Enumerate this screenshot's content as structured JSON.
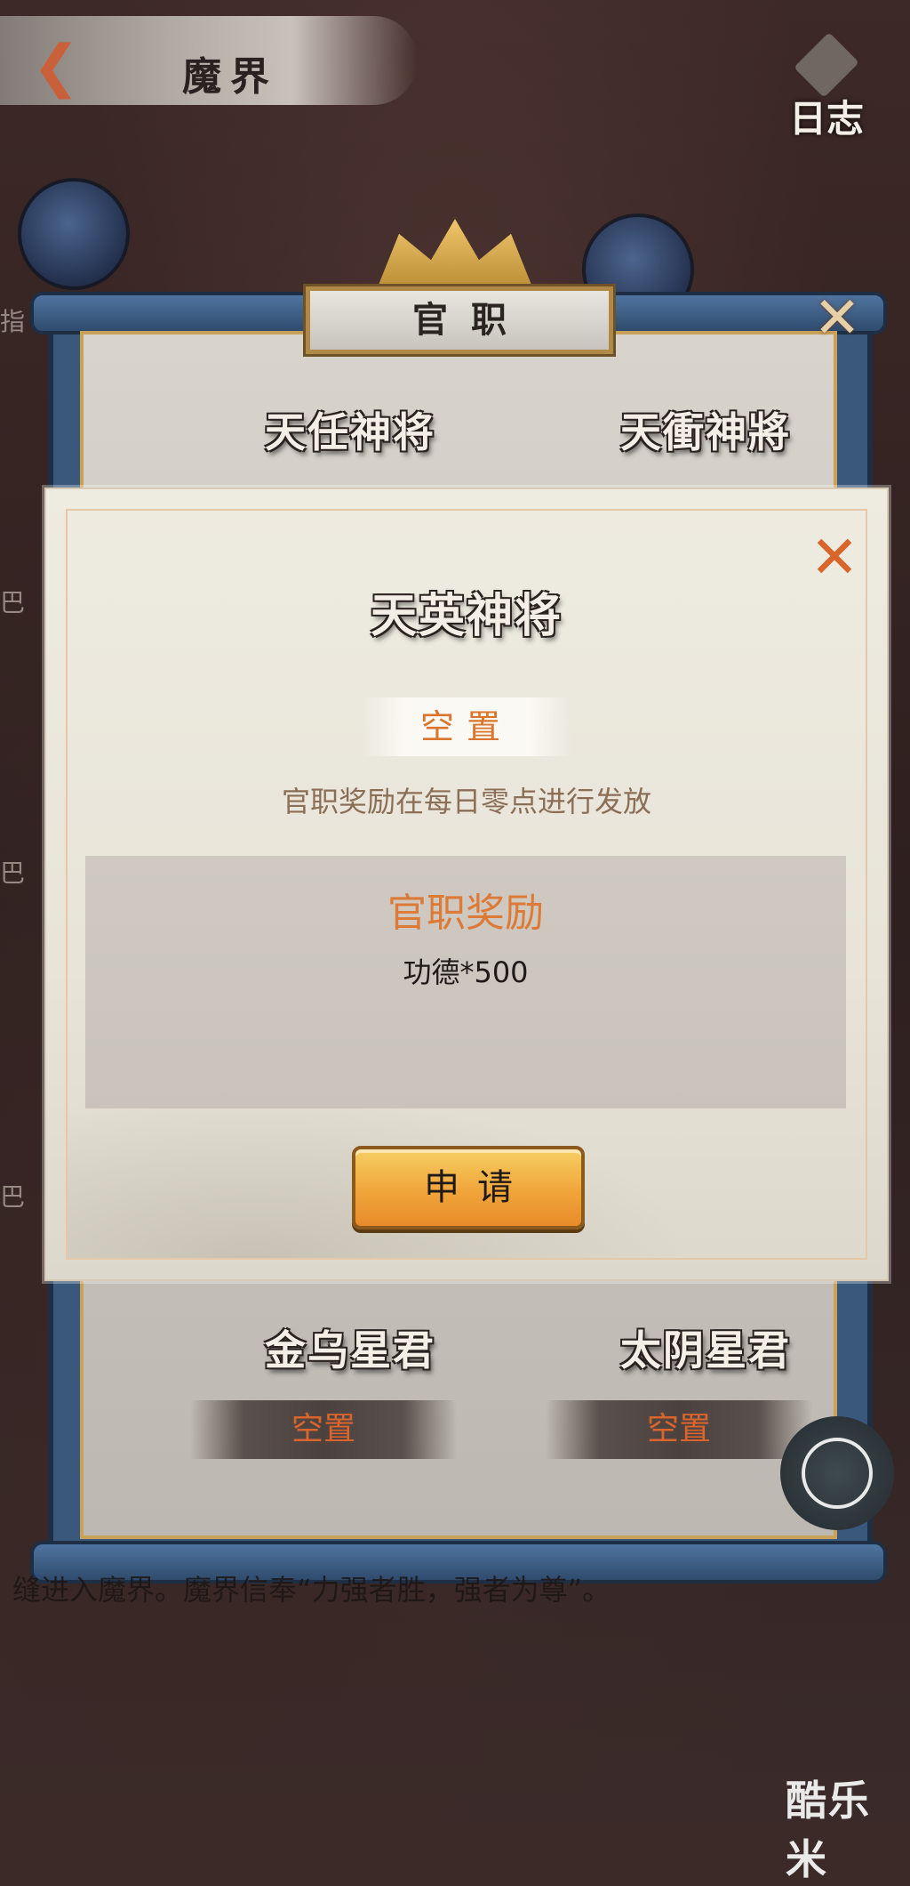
{
  "header": {
    "back_icon": "back-arrow-icon",
    "title": "魔界",
    "log_label": "日志"
  },
  "background": {
    "side_labels": [
      "指",
      "巴",
      "巴",
      "巴"
    ],
    "bottom_text": "缝进入魔界。魔界信奉“力强者胜，强者为尊”。"
  },
  "office_panel": {
    "title": "官职",
    "ranks": [
      {
        "title": "天任神将"
      },
      {
        "title": "天衝神將"
      },
      {
        "title": "金乌星君",
        "status": "空置"
      },
      {
        "title": "太阴星君",
        "status": "空置"
      }
    ]
  },
  "modal": {
    "rank_title": "天英神将",
    "status": "空置",
    "note": "官职奖励在每日零点进行发放",
    "reward_title": "官职奖励",
    "reward_item": "功德*500",
    "apply_label": "申请"
  },
  "watermark": "酷乐米",
  "colors": {
    "accent_orange": "#d9752c",
    "panel_blue": "#3a587b",
    "gold_border": "#c9a25a",
    "button_gold": "#f0a53a"
  }
}
